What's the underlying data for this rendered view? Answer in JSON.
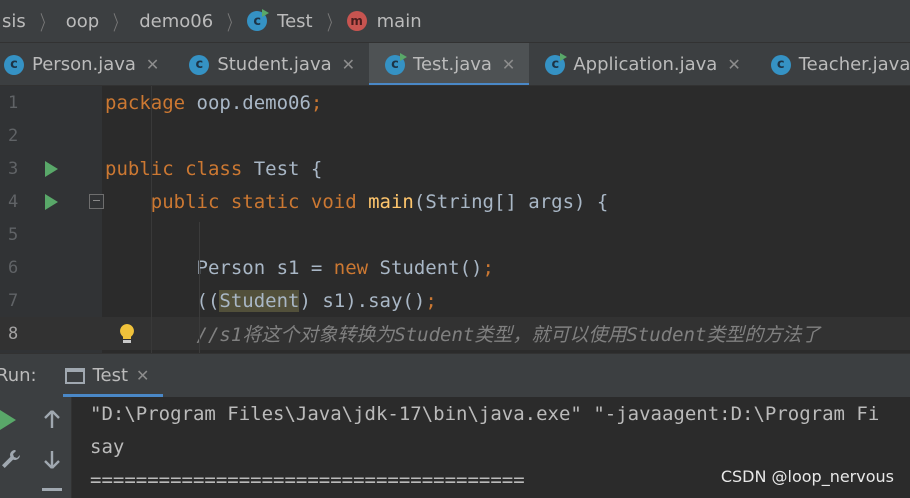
{
  "breadcrumb": {
    "items": [
      {
        "label": "sis",
        "icon": "none"
      },
      {
        "label": "oop",
        "icon": "none"
      },
      {
        "label": "demo06",
        "icon": "none"
      },
      {
        "label": "Test",
        "icon": "class-icon"
      },
      {
        "label": "main",
        "icon": "method-icon"
      }
    ],
    "method_icon_letter": "m"
  },
  "tabs": [
    {
      "label": "Person.java",
      "active": false
    },
    {
      "label": "Student.java",
      "active": false
    },
    {
      "label": "Test.java",
      "active": true
    },
    {
      "label": "Application.java",
      "active": false
    },
    {
      "label": "Teacher.java",
      "active": false
    }
  ],
  "class_icon_letter": "c",
  "editor": {
    "lines": [
      {
        "num": "1",
        "tokens": [
          {
            "t": "package ",
            "c": "kw"
          },
          {
            "t": "oop.demo06",
            "c": ""
          },
          {
            "t": ";",
            "c": "kw"
          }
        ]
      },
      {
        "num": "2",
        "tokens": []
      },
      {
        "num": "3",
        "tokens": [
          {
            "t": "public class ",
            "c": "kw"
          },
          {
            "t": "Test {",
            "c": ""
          }
        ],
        "run": true
      },
      {
        "num": "4",
        "tokens": [
          {
            "t": "    public static void ",
            "c": "kw"
          },
          {
            "t": "main",
            "c": "fn"
          },
          {
            "t": "(String[] args) {",
            "c": ""
          }
        ],
        "run": true,
        "fold": true
      },
      {
        "num": "5",
        "tokens": []
      },
      {
        "num": "6",
        "tokens": [
          {
            "t": "        Person s1 = ",
            "c": ""
          },
          {
            "t": "new ",
            "c": "kw"
          },
          {
            "t": "Student()",
            "c": ""
          },
          {
            "t": ";",
            "c": "kw"
          }
        ]
      },
      {
        "num": "7",
        "tokens": [
          {
            "t": "        ((",
            "c": ""
          },
          {
            "t": "Student",
            "c": "hl"
          },
          {
            "t": ") s1).say()",
            "c": ""
          },
          {
            "t": ";",
            "c": "kw"
          }
        ]
      },
      {
        "num": "8",
        "tokens": [
          {
            "t": "        //s1将这个对象转换为Student类型，就可以使用Student类型的方法了",
            "c": "cm"
          }
        ],
        "current": true,
        "bulb": true
      }
    ]
  },
  "run_panel": {
    "label": "Run:",
    "tab": "Test",
    "console": [
      "\"D:\\Program Files\\Java\\jdk-17\\bin\\java.exe\" \"-javaagent:D:\\Program Fi",
      "say",
      "======================================"
    ]
  },
  "watermark": "CSDN @loop_nervous",
  "colors": {
    "keyword": "#cc7832",
    "method": "#ffc66d",
    "comment": "#808080",
    "accent": "#4a88c7",
    "run": "#59a869"
  }
}
